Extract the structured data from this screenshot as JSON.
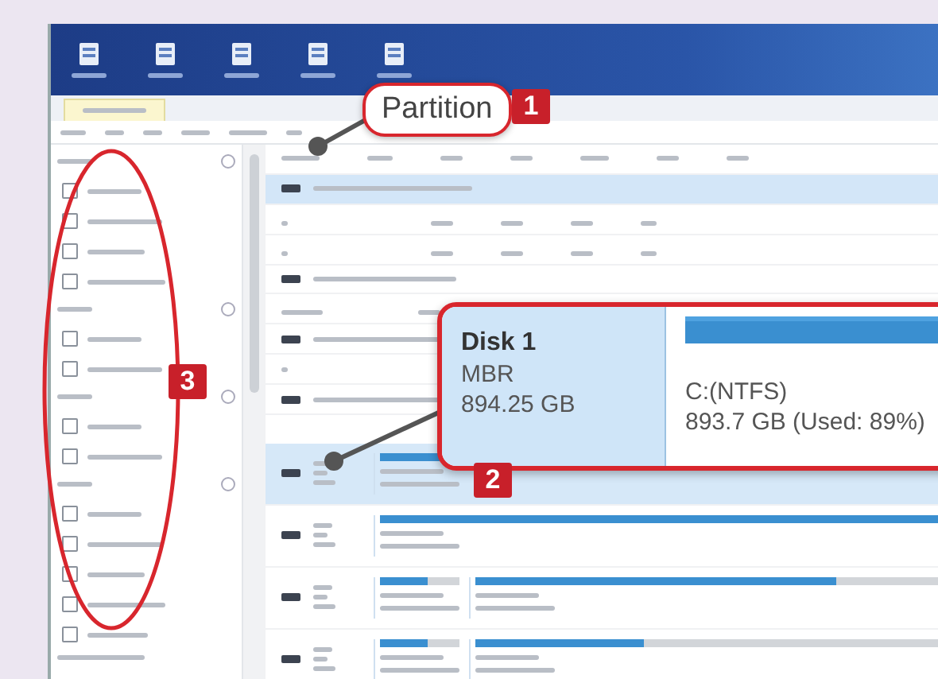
{
  "callouts": [
    {
      "number": "1",
      "label": "Partition"
    },
    {
      "number": "2"
    },
    {
      "number": "3"
    }
  ],
  "disk_detail": {
    "name": "Disk 1",
    "style": "MBR",
    "size": "894.25 GB",
    "partition": "C:(NTFS)",
    "usage": "893.7 GB (Used: 89%)"
  }
}
